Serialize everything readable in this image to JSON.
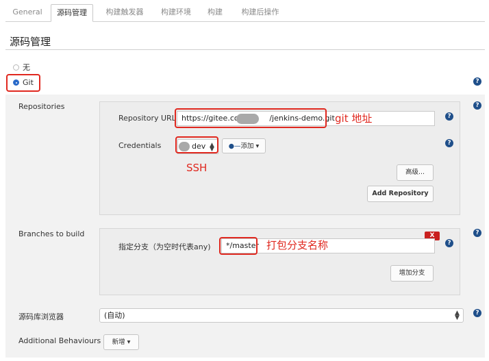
{
  "tabs": [
    {
      "label": "General"
    },
    {
      "label": "源码管理",
      "active": true
    },
    {
      "label": "构建触发器"
    },
    {
      "label": "构建环境"
    },
    {
      "label": "构建"
    },
    {
      "label": "构建后操作"
    }
  ],
  "section": {
    "title": "源码管理"
  },
  "scm_options": {
    "none_label": "无",
    "git_label": "Git",
    "selected": "Git"
  },
  "repositories": {
    "label": "Repositories",
    "url_label": "Repository URL",
    "url_value": "https://gitee.com/***/jenkins-demo.git",
    "url_before": "https://gitee.com",
    "url_after": "/jenkins-demo.git",
    "credentials_label": "Credentials",
    "credentials_value": "dev",
    "add_button": "添加",
    "advanced_button": "高级...",
    "add_repo_button": "Add Repository"
  },
  "annotations": {
    "git_address": "git 地址",
    "ssh": "SSH",
    "branch_name": "打包分支名称"
  },
  "branches": {
    "label": "Branches to build",
    "specifier_label": "指定分支（为空时代表any)",
    "specifier_value": "*/master",
    "delete_label": "X",
    "add_branch_button": "增加分支"
  },
  "browser": {
    "label": "源码库浏览器",
    "value": "(自动)"
  },
  "behaviours": {
    "label": "Additional Behaviours",
    "add_button": "新增"
  },
  "help_symbol": "?",
  "colors": {
    "accent_red": "#e0281f",
    "help_blue": "#1f4f8a",
    "radio_blue": "#2a6ac9"
  }
}
